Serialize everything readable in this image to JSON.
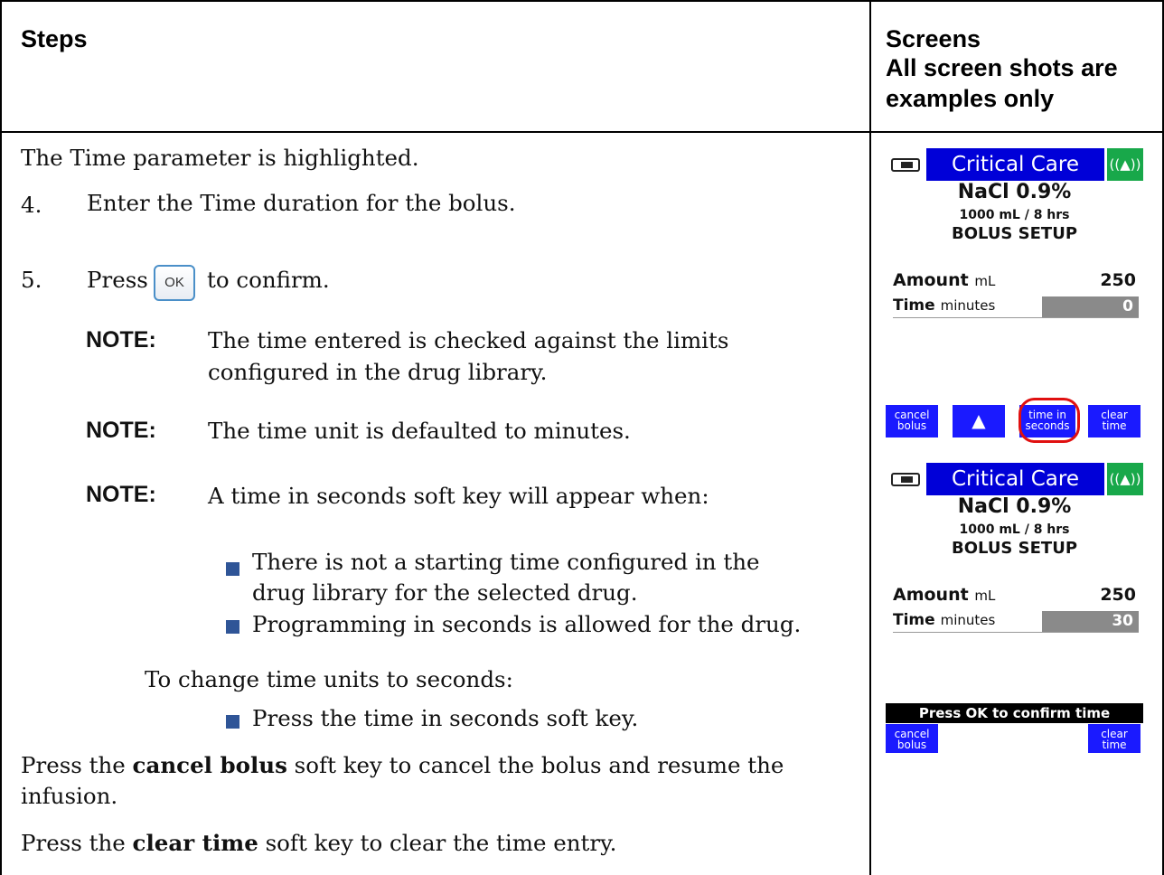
{
  "header": {
    "steps": "Steps",
    "screens_line1": "Screens",
    "screens_line2": "All screen shots are",
    "screens_line3": "examples only"
  },
  "steps": {
    "intro": "The Time parameter is highlighted.",
    "step4_num": "4.",
    "step4_text": "Enter the Time duration for the bolus.",
    "step5_num": "5.",
    "step5_before": "Press",
    "step5_key": "OK",
    "step5_after": "to confirm.",
    "note_label": "NOTE:",
    "note1_line1": "The time entered is checked against the limits",
    "note1_line2": "configured in the drug library.",
    "note2": "The time unit is defaulted to minutes.",
    "note3": "A time in seconds soft key will appear when:",
    "bullet1_line1": "There is not a starting time configured in the",
    "bullet1_line2": "drug library for the selected drug.",
    "bullet2": "Programming in seconds is allowed for the drug.",
    "change_units": "To change time units to seconds:",
    "bullet3": "Press the time in seconds soft key.",
    "cancel_before": "Press the ",
    "cancel_bold": "cancel bolus",
    "cancel_after": " soft key to cancel the bolus and resume the",
    "cancel_line2": "infusion.",
    "clear_before": "Press the ",
    "clear_bold": "clear time",
    "clear_after": " soft key to clear the time entry."
  },
  "screen1": {
    "title": "Critical Care",
    "drug": "NaCl 0.9%",
    "volume": "1000 mL / 8 hrs",
    "mode": "BOLUS SETUP",
    "amount_label": "Amount",
    "amount_unit": "mL",
    "amount_value": "250",
    "time_label": "Time",
    "time_unit": "minutes",
    "time_value": "0",
    "softkeys": {
      "cancel_l1": "cancel",
      "cancel_l2": "bolus",
      "up_arrow": "▲",
      "seconds_l1": "time in",
      "seconds_l2": "seconds",
      "clear_l1": "clear",
      "clear_l2": "time"
    }
  },
  "screen2": {
    "title": "Critical Care",
    "drug": "NaCl 0.9%",
    "volume": "1000 mL / 8 hrs",
    "mode": "BOLUS SETUP",
    "amount_label": "Amount",
    "amount_unit": "mL",
    "amount_value": "250",
    "time_label": "Time",
    "time_unit": "minutes",
    "time_value": "30",
    "message": "Press OK to confirm time",
    "softkeys": {
      "cancel_l1": "cancel",
      "cancel_l2": "bolus",
      "clear_l1": "clear",
      "clear_l2": "time"
    }
  },
  "colors": {
    "title_bar": "#0000d8",
    "wireless_badge": "#18a84a",
    "softkey": "#1a1aff",
    "bullet": "#2f5597",
    "highlight_circle": "#e01010"
  },
  "icons": {
    "battery": "battery-icon",
    "wireless": "wireless-icon",
    "bullet": "square-bullet-icon"
  }
}
